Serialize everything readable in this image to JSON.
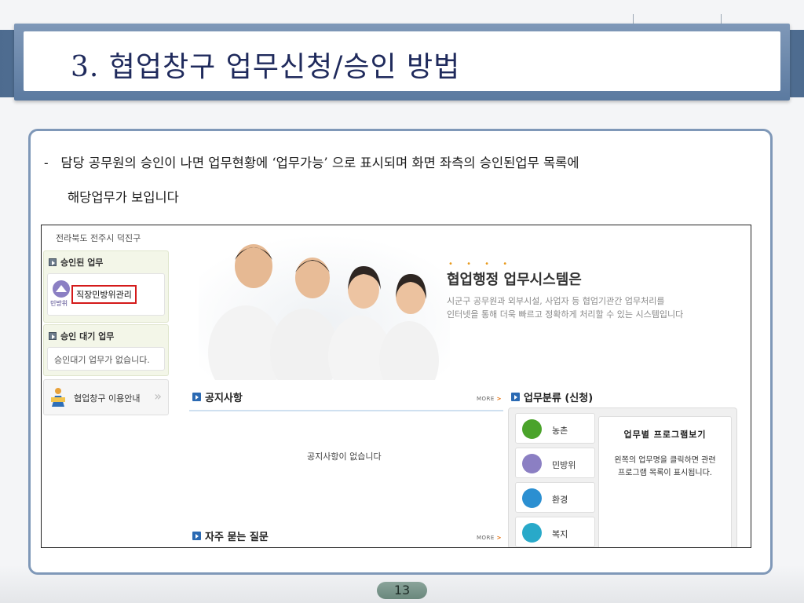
{
  "slide": {
    "title": "3. 협업창구 업무신청/승인 방법",
    "bullet_dash": "-",
    "bullet_line1": "담당 공무원의 승인이 나면 업무현황에 ‘업무가능’ 으로 표시되며 화면 좌측의 승인된업무 목록에",
    "bullet_line2": "해당업무가 보입니다",
    "page_number": "13"
  },
  "screenshot": {
    "region": "전라북도 전주시 덕진구",
    "sidebar": {
      "approved_head": "승인된 업무",
      "approved_icon_label": "민방위",
      "approved_item": "직장민방위관리",
      "pending_head": "승인 대기 업무",
      "pending_empty": "승인대기 업무가 없습니다.",
      "guide_label": "협업창구 이용안내",
      "guide_arrow": "»"
    },
    "hero": {
      "dots": "• • • •",
      "title": "협업행정 업무시스템은",
      "desc1": "시군구 공무원과 외부시설, 사업자 등 협업기관간 업무처리를",
      "desc2": "인터넷을 통해 더욱 빠르고 정확하게 처리할 수 있는 시스템입니다"
    },
    "notice": {
      "title": "공지사항",
      "more": "MORE",
      "empty": "공지사항이 없습니다"
    },
    "faq": {
      "title": "자주 묻는 질문",
      "more": "MORE"
    },
    "category": {
      "title": "업무분류 (신청)",
      "items": [
        {
          "label": "농촌",
          "color": "#4aa32a"
        },
        {
          "label": "민방위",
          "color": "#8b7fc3"
        },
        {
          "label": "환경",
          "color": "#2b8fd1"
        },
        {
          "label": "복지",
          "color": "#28a9c9"
        }
      ],
      "panel_title": "업무별 프로그램보기",
      "panel_desc1": "왼쪽의 업무명을 클릭하면 관련",
      "panel_desc2": "프로그램 목록이 표시됩니다."
    }
  }
}
